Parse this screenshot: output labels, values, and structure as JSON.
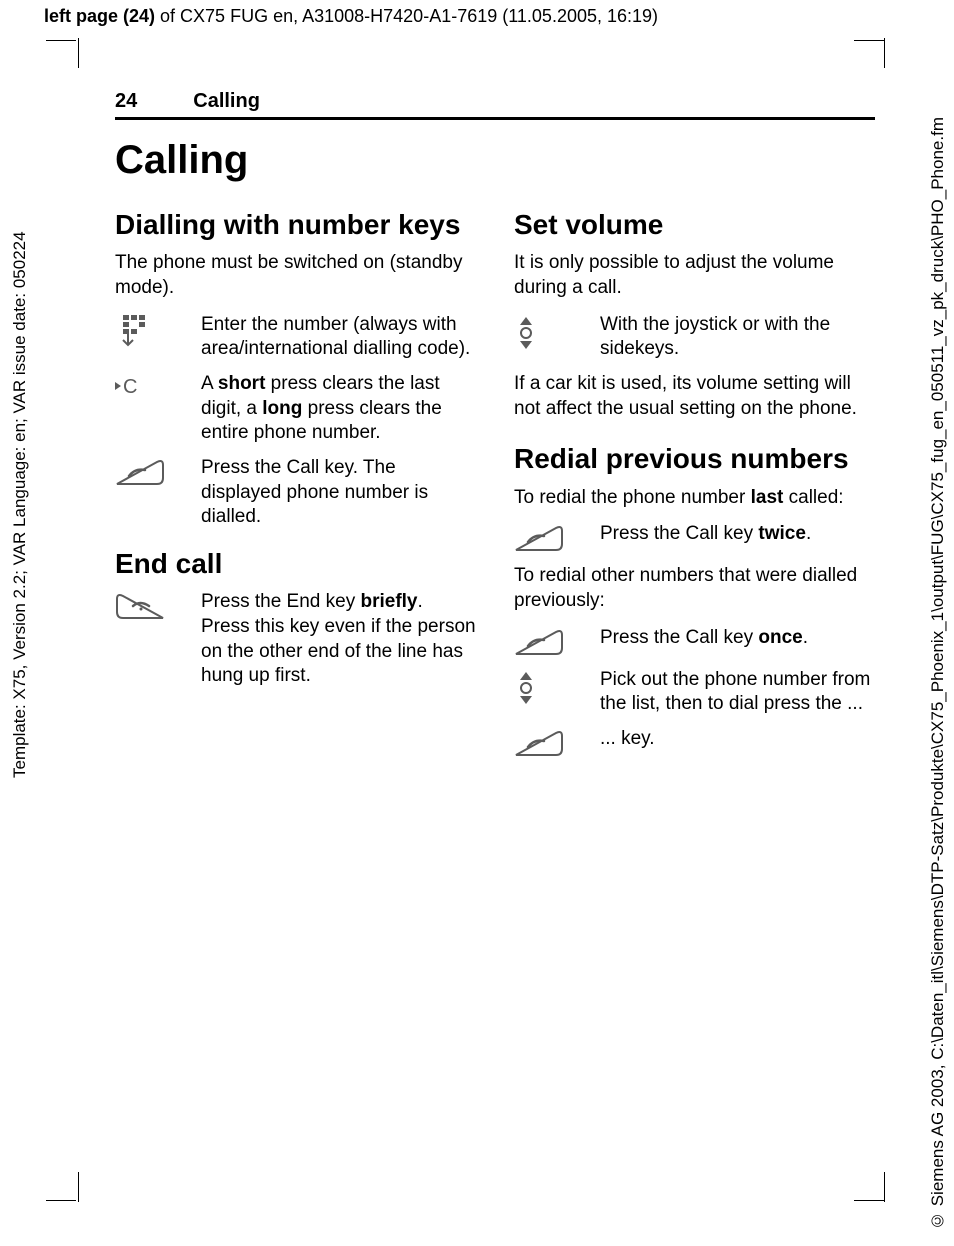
{
  "meta": {
    "top_prefix_bold": "left page (24)",
    "top_rest": " of CX75 FUG en, A31008-H7420-A1-7619 (11.05.2005, 16:19)",
    "left_margin": "Template: X75, Version 2.2; VAR Language: en; VAR issue date: 050224",
    "right_margin": "© Siemens AG 2003, C:\\Daten_itl\\Siemens\\DTP-Satz\\Produkte\\CX75_Phoenix_1\\output\\FUG\\CX75_fug_en_050511_vz_pk_druck\\PHO_Phone.fm"
  },
  "running_head": {
    "page_number": "24",
    "section": "Calling"
  },
  "title": "Calling",
  "left_col": {
    "h_dial": "Dialling with number keys",
    "p_dial": "The phone must be switched on (standby mode).",
    "item1": "Enter the number (always with area/international dialling code).",
    "item2_a": "A ",
    "item2_b": "short",
    "item2_c": " press clears the last digit, a ",
    "item2_d": "long",
    "item2_e": " press clears the entire phone number.",
    "item3": "Press the Call key. The displayed phone number is dialled.",
    "h_end": "End call",
    "end_a": "Press the End key ",
    "end_b": "briefly",
    "end_c": ". Press this key even if the person on the other end of the line has hung up first."
  },
  "right_col": {
    "h_vol": "Set volume",
    "p_vol1": "It is only possible to adjust the volume during a call.",
    "vol_item": "With the joystick or with the sidekeys.",
    "p_vol2": "If a car kit is used, its volume setting will not affect the usual setting on the phone.",
    "h_redial": "Redial previous numbers",
    "redial_p1_a": "To redial the phone number ",
    "redial_p1_b": "last",
    "redial_p1_c": " called:",
    "redial_item1_a": "Press the Call key ",
    "redial_item1_b": "twice",
    "redial_item1_c": ".",
    "redial_p2": "To redial other numbers that were dialled previously:",
    "redial_item2_a": "Press the Call key ",
    "redial_item2_b": "once",
    "redial_item2_c": ".",
    "redial_item3": "Pick out the phone number from the list, then to dial press the ...",
    "redial_item4": "... key."
  }
}
